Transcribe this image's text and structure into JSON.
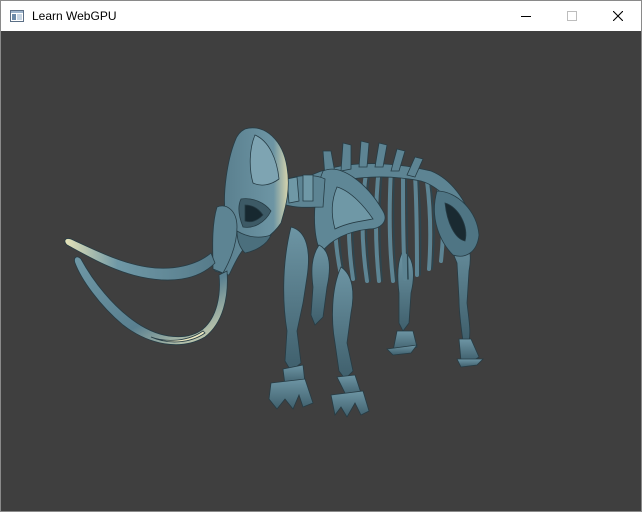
{
  "window": {
    "title": "Learn WebGPU",
    "app_icon": "window-app-icon",
    "controls": {
      "minimize_icon": "minimize-icon",
      "maximize_icon": "maximize-icon",
      "close_icon": "close-icon"
    }
  },
  "viewport": {
    "background_color": "#3f3f3f",
    "scene": "mammoth-skeleton-model",
    "bone_color": "#5d8493",
    "highlight_color": "#e6e3b8"
  }
}
